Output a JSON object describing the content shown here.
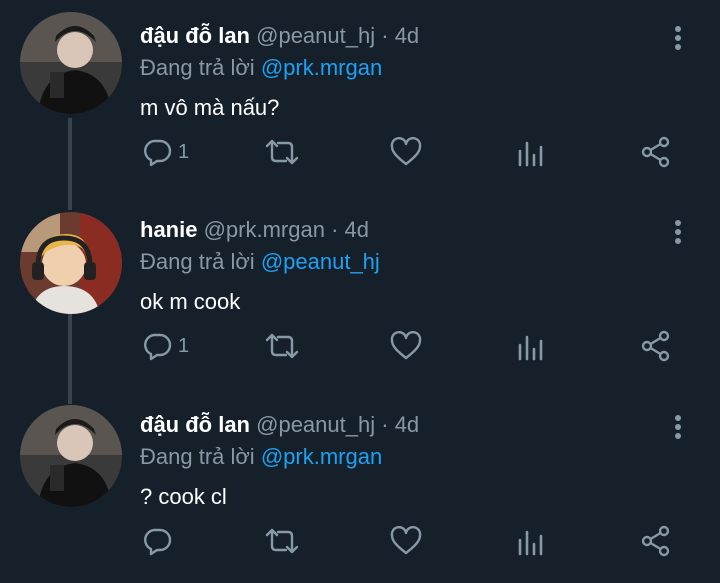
{
  "tweets": [
    {
      "name": "đậu đỗ lan",
      "handle": "@peanut_hj",
      "dot": "·",
      "time": "4d",
      "reply_prefix": "Đang trả lời",
      "reply_to": "@prk.mrgan",
      "text": "m vô mà nấu?",
      "reply_count": "1"
    },
    {
      "name": "hanie",
      "handle": "@prk.mrgan",
      "dot": "·",
      "time": "4d",
      "reply_prefix": "Đang trả lời",
      "reply_to": "@peanut_hj",
      "text": "ok m cook",
      "reply_count": "1"
    },
    {
      "name": "đậu đỗ lan",
      "handle": "@peanut_hj",
      "dot": "·",
      "time": "4d",
      "reply_prefix": "Đang trả lời",
      "reply_to": "@prk.mrgan",
      "text": "? cook cl",
      "reply_count": ""
    }
  ],
  "icons": {
    "reply": "reply-icon",
    "retweet": "retweet-icon",
    "like": "heart-icon",
    "analytics": "analytics-icon",
    "share": "share-icon",
    "more": "more-vertical-icon"
  },
  "colors": {
    "background": "#15202b",
    "secondary_text": "#8899a6",
    "mention": "#1da1f2",
    "thread_line": "#38444d"
  }
}
